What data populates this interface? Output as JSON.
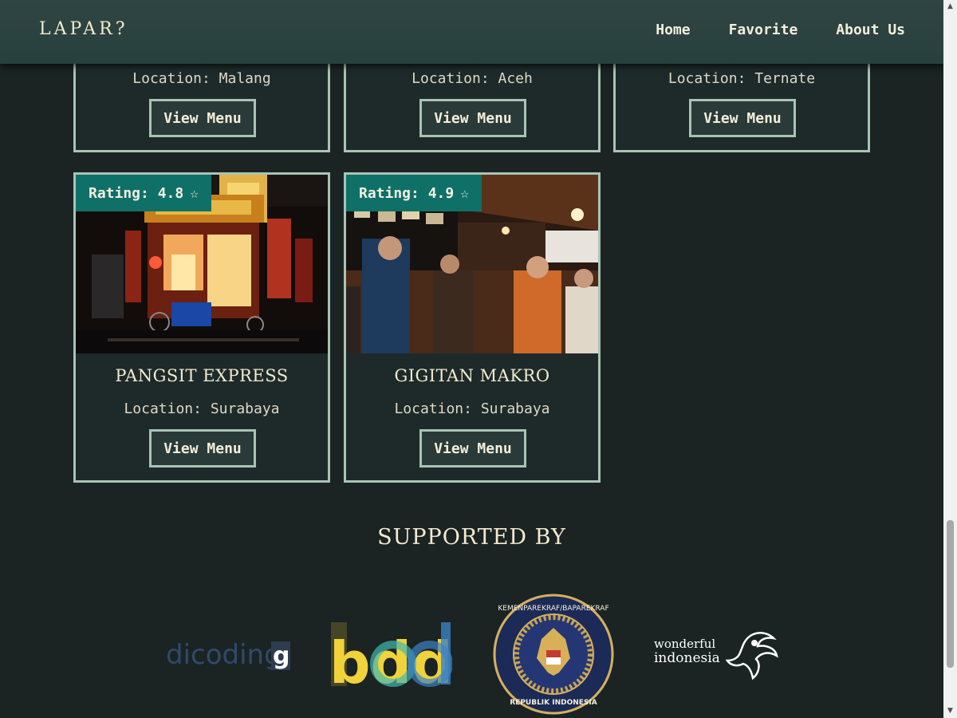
{
  "header": {
    "brand": "LAPAR?",
    "nav": [
      {
        "label": "Home"
      },
      {
        "label": "Favorite"
      },
      {
        "label": "About Us"
      }
    ]
  },
  "top_cards": [
    {
      "location": "Location: Malang",
      "button": "View Menu"
    },
    {
      "location": "Location: Aceh",
      "button": "View Menu"
    },
    {
      "location": "Location: Ternate",
      "button": "View Menu"
    }
  ],
  "restaurants": [
    {
      "rating": "Rating: 4.8",
      "name": "PANGSIT EXPRESS",
      "location": "Location: Surabaya",
      "button": "View Menu",
      "star_icon": "star-outline-icon"
    },
    {
      "rating": "Rating: 4.9",
      "name": "GIGITAN MAKRO",
      "location": "Location: Surabaya",
      "button": "View Menu",
      "star_icon": "star-outline-icon"
    }
  ],
  "supported": {
    "title": "SUPPORTED BY",
    "logos": {
      "dicoding": "dicoding",
      "bdd": "bdd",
      "kemenparekraf_text": "KEMENPAREKRAF/BAPAREKRAF",
      "kemenparekraf_bottom": "REPUBLIK INDONESIA",
      "wonderful_top": "wonderful",
      "wonderful_bottom": "indonesia"
    }
  },
  "colors": {
    "background": "#1b2323",
    "header": "#2f4543",
    "badge": "#0f7068",
    "border": "#a9c3b5",
    "text": "#f1ebd0"
  }
}
